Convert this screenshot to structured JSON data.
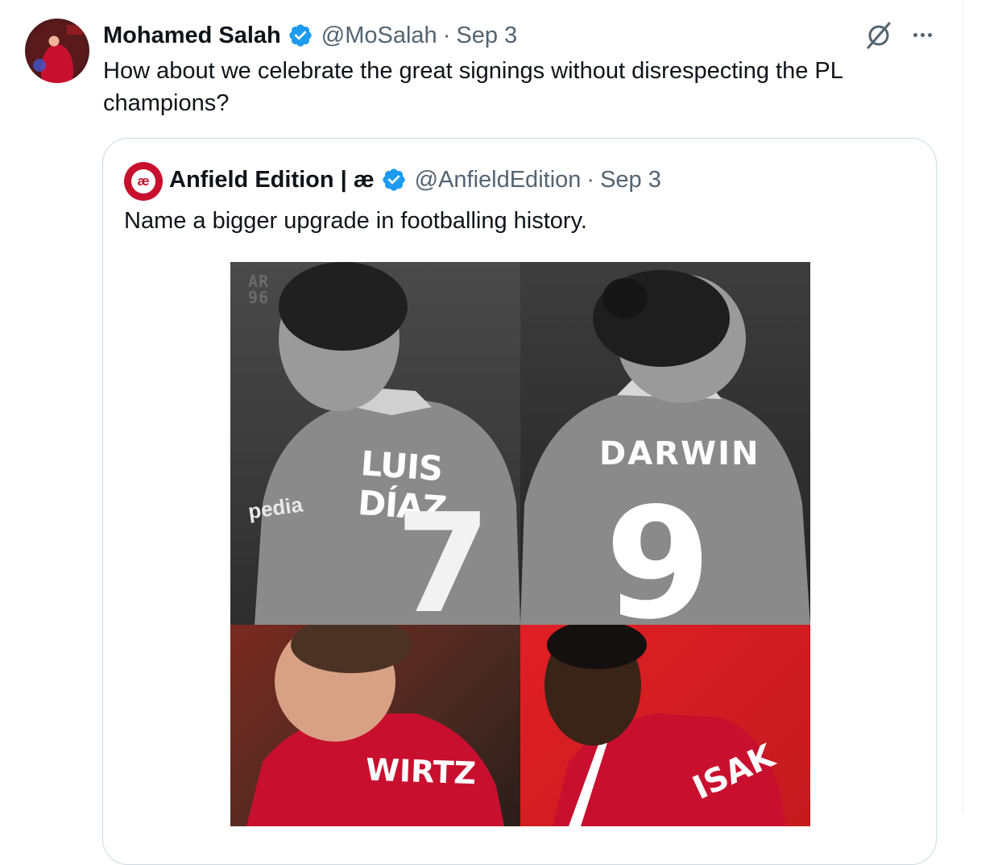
{
  "tweet": {
    "author_name": "Mohamed Salah",
    "author_handle": "@MoSalah",
    "separator": "·",
    "date": "Sep 3",
    "text": "How about we celebrate the great signings without disrespecting the PL champions?",
    "verified_color": "#1d9bf0"
  },
  "quote": {
    "author_name": "Anfield Edition | æ",
    "avatar_text": "æ",
    "author_handle": "@AnfieldEdition",
    "separator": "·",
    "date": "Sep 3",
    "text": "Name a bigger upgrade in footballing history."
  },
  "media": {
    "watermark_line1": "AR",
    "watermark_line2": "96",
    "panel1": {
      "shirt_name": "LUIS DÍAZ",
      "number": "7",
      "sponsor": "pedia"
    },
    "panel2": {
      "shirt_name": "DARWIN",
      "number": "9"
    },
    "panel3": {
      "shirt_name": "WIRTZ"
    },
    "panel4": {
      "shirt_name": "ISAK"
    }
  },
  "icons": {
    "verified": "verified-badge-icon",
    "grok": "grok-icon",
    "more": "more-options-icon"
  }
}
